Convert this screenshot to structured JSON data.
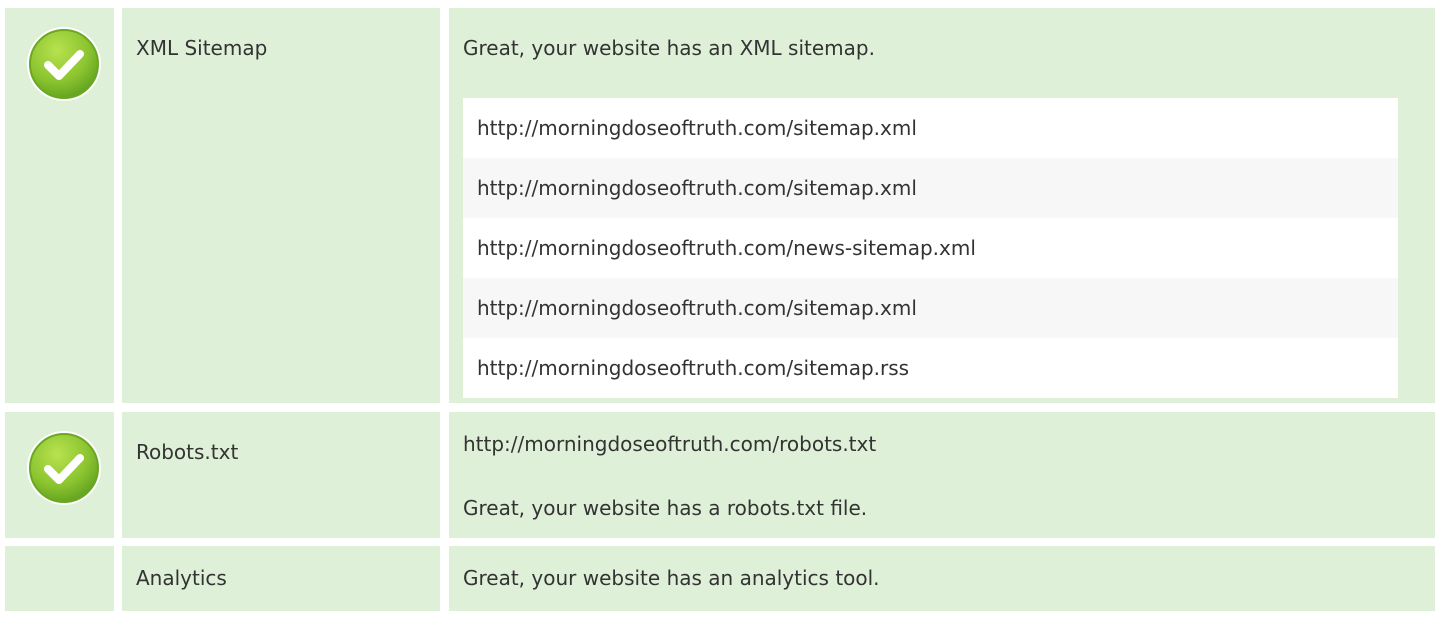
{
  "rows": [
    {
      "label": "XML Sitemap",
      "status_icon": "check-circle-icon",
      "message": "Great, your website has an XML sitemap.",
      "urls": [
        "http://morningdoseoftruth.com/sitemap.xml",
        "http://morningdoseoftruth.com/sitemap.xml",
        "http://morningdoseoftruth.com/news-sitemap.xml",
        "http://morningdoseoftruth.com/sitemap.xml",
        "http://morningdoseoftruth.com/sitemap.rss"
      ]
    },
    {
      "label": "Robots.txt",
      "status_icon": "check-circle-icon",
      "url": "http://morningdoseoftruth.com/robots.txt",
      "message": "Great, your website has a robots.txt file."
    },
    {
      "label": "Analytics",
      "status_icon": "",
      "message": "Great, your website has an analytics tool."
    }
  ],
  "colors": {
    "row_background": "#dff0d8",
    "check_green_light": "#a4d63b",
    "check_green_dark": "#5f9f1e",
    "list_row_white": "#ffffff",
    "list_row_gray": "#f7f7f7",
    "text": "#333333"
  }
}
